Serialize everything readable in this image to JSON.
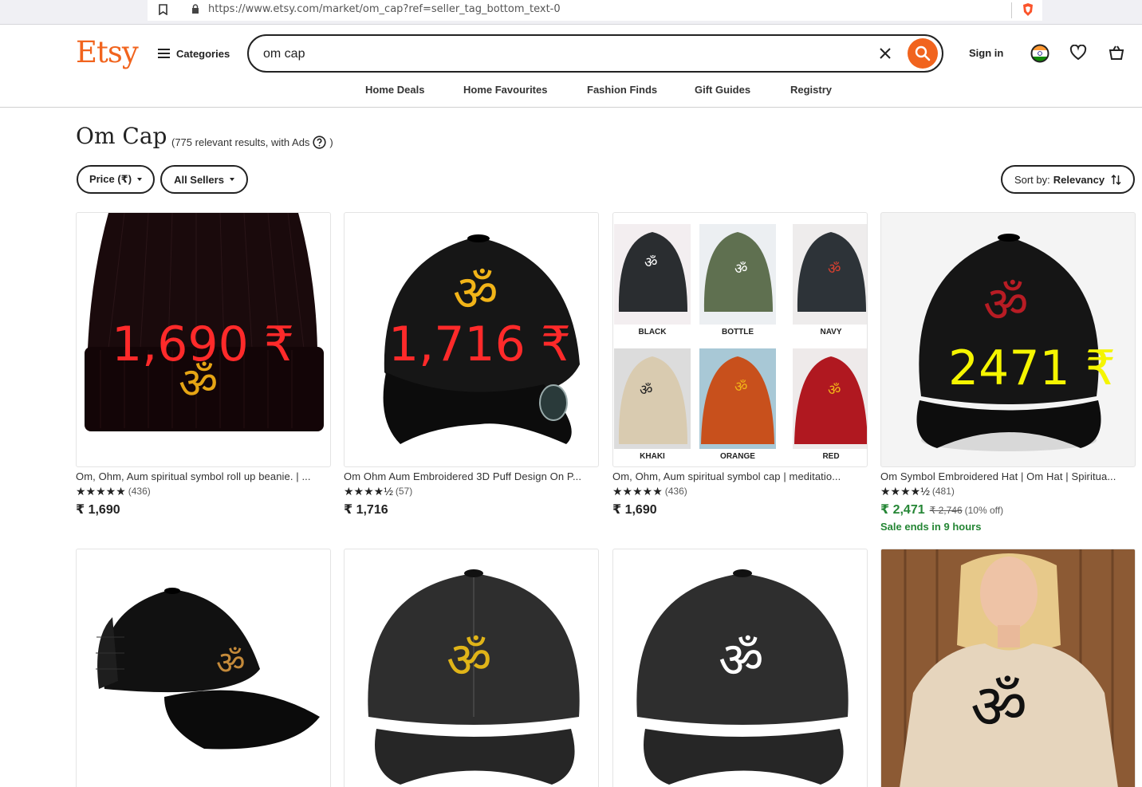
{
  "browser": {
    "url": "https://www.etsy.com/market/om_cap?ref=seller_tag_bottom_text-0"
  },
  "header": {
    "logo": "Etsy",
    "categories_label": "Categories",
    "search_value": "om cap",
    "sign_in": "Sign in"
  },
  "nav": [
    "Home Deals",
    "Home Favourites",
    "Fashion Finds",
    "Gift Guides",
    "Registry"
  ],
  "page": {
    "title": "Om Cap",
    "results_note": "(775 relevant results, with Ads",
    "results_note_end": ")"
  },
  "filters": {
    "price": "Price (₹)",
    "sellers": "All Sellers",
    "sort_prefix": "Sort by:",
    "sort_value": "Relevancy"
  },
  "colors": {
    "brand": "#f1641e",
    "sale_green": "#258635",
    "overlay_red": "#ff2a2a",
    "overlay_yellow": "#f5f500",
    "om_gold": "#e6a514"
  },
  "products": [
    {
      "title": "Om, Ohm, Aum spiritual symbol roll up beanie. | ...",
      "stars": "★★★★★",
      "reviews": "(436)",
      "price": "₹ 1,690",
      "overlay": "1,690 ₹"
    },
    {
      "title": "Om Ohm Aum Embroidered 3D Puff Design On P...",
      "stars": "★★★★½",
      "reviews": "(57)",
      "price": "₹ 1,716",
      "overlay": "1,716 ₹"
    },
    {
      "title": "Om, Ohm, Aum spiritual symbol cap | meditatio...",
      "stars": "★★★★★",
      "reviews": "(436)",
      "price": "₹ 1,690",
      "swatches": [
        "BLACK",
        "BOTTLE",
        "NAVY",
        "KHAKI",
        "ORANGE",
        "RED"
      ]
    },
    {
      "title": "Om Symbol Embroidered Hat | Om Hat | Spiritua...",
      "stars": "★★★★½",
      "reviews": "(481)",
      "price": "₹ 2,471",
      "original_price": "₹ 2,746",
      "discount": "(10% off)",
      "sale_note": "Sale ends in 9 hours",
      "overlay": "2471 ₹"
    }
  ],
  "om_symbol": "ॐ"
}
